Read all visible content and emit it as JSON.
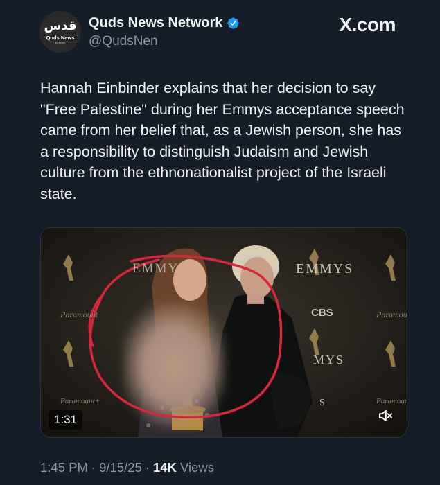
{
  "account": {
    "display_name": "Quds News Network",
    "handle": "@QudsNen",
    "verified": true,
    "avatar_logo": "ﻗﺪﺱ",
    "avatar_sub": "Quds News",
    "avatar_tiny": "Network"
  },
  "site_badge": "X.com",
  "tweet": {
    "text": "Hannah Einbinder explains that her decision to say \"Free Palestine\"  during her Emmys acceptance speech came from her belief that, as a Jewish person, she has a responsibility to distinguish Judaism and Jewish culture from the ethnonationalist project of the Israeli state."
  },
  "media": {
    "type": "video",
    "duration": "1:31",
    "backdrop_text": {
      "emmys_top_left": "EMMY",
      "emmys_top_right": "EMMYS",
      "cbs": "CBS",
      "emmys_mid": "MYS",
      "paramount_left": "Paramount",
      "paramount_right": "Paramoun",
      "paramount_bottom_left": "Paramount+",
      "paramount_bottom_right": "Paramoun",
      "s_fragment": "S"
    },
    "mute_icon": "speaker-muted-icon"
  },
  "footer": {
    "time": "1:45 PM",
    "date": "9/15/25",
    "views_count": "14K",
    "views_label": "Views",
    "separator": "·"
  },
  "colors": {
    "background": "#151d28",
    "verified": "#1d9bf0",
    "secondary_text": "#8b98a5",
    "circle_annotation": "#d8263c"
  }
}
